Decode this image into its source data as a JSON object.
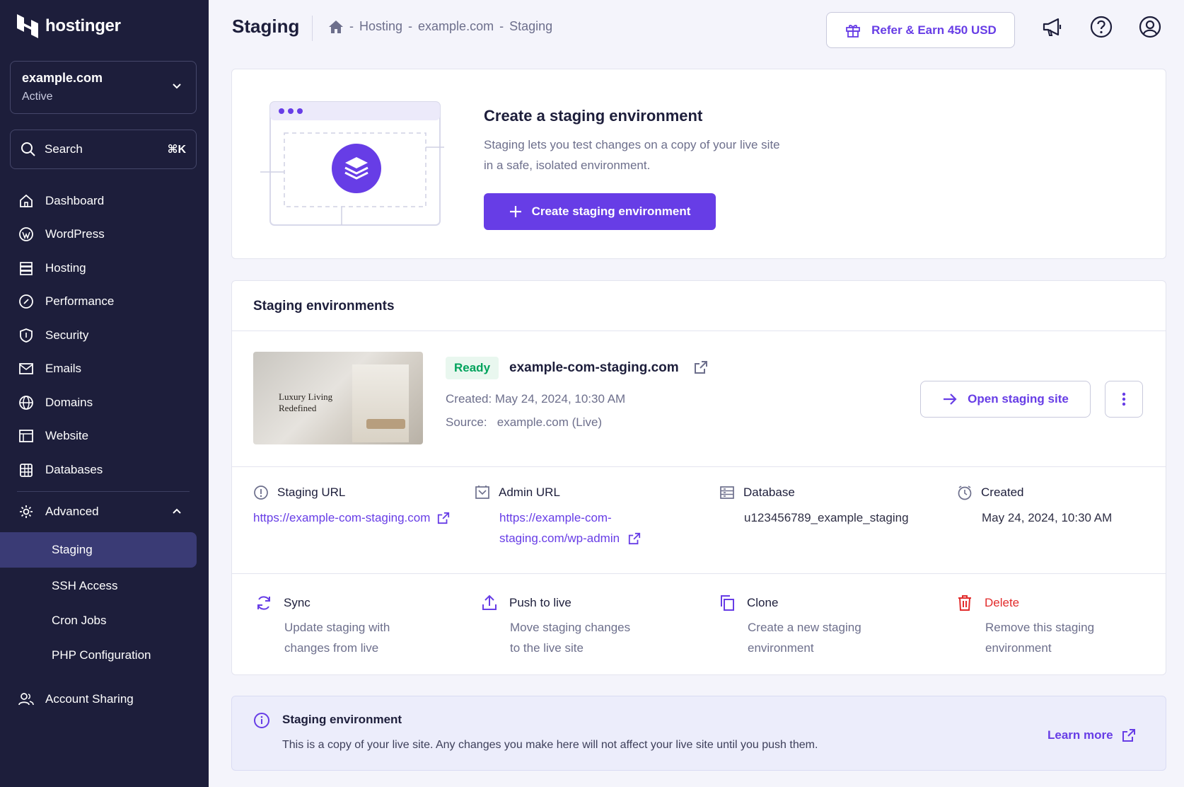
{
  "sidebar": {
    "brand": "hostinger",
    "site": {
      "name": "example.com",
      "status": "Active"
    },
    "search": {
      "label": "Search",
      "shortcut": "⌘K"
    },
    "nav": [
      {
        "label": "Dashboard",
        "icon": "home-icon"
      },
      {
        "label": "WordPress",
        "icon": "wordpress-icon"
      },
      {
        "label": "Hosting",
        "icon": "server-icon"
      },
      {
        "label": "Performance",
        "icon": "gauge-icon"
      },
      {
        "label": "Security",
        "icon": "shield-icon"
      },
      {
        "label": "Emails",
        "icon": "mail-icon"
      },
      {
        "label": "Domains",
        "icon": "globe-icon"
      },
      {
        "label": "Website",
        "icon": "browser-icon"
      },
      {
        "label": "Databases",
        "icon": "database-icon"
      }
    ],
    "advanced": {
      "label": "Advanced",
      "items": [
        "Staging",
        "SSH Access",
        "Cron Jobs",
        "PHP Configuration"
      ]
    },
    "account_sharing": "Account Sharing"
  },
  "header": {
    "title": "Staging",
    "breadcrumb": [
      "Hosting",
      "example.com",
      "Staging"
    ],
    "breadcrumb_sep": "-",
    "refer": "Refer & Earn 450 USD"
  },
  "create": {
    "title": "Create a staging environment",
    "desc_line1": "Staging lets you test changes on a copy of your live site",
    "desc_line2": "in a safe, isolated environment.",
    "button": "Create staging environment"
  },
  "environments": {
    "title": "Staging environments",
    "item": {
      "thumb_text_line1": "Luxury Living",
      "thumb_text_line2": "Redefined",
      "status": "Ready",
      "domain": "example-com-staging.com",
      "created": "Created: May 24, 2024, 10:30 AM",
      "source_label": "Source:",
      "source_value": "example.com (Live)",
      "open_button": "Open staging site"
    },
    "details": {
      "staging_url": {
        "label": "Staging URL",
        "value": "https://example-com-staging.com"
      },
      "admin_url": {
        "label": "Admin URL",
        "line1": "https://example-com-",
        "line2": "staging.com/wp-admin"
      },
      "database": {
        "label": "Database",
        "value": "u123456789_example_staging"
      },
      "created": {
        "label": "Created",
        "value": "May 24, 2024, 10:30 AM"
      }
    },
    "actions": {
      "sync": {
        "label": "Sync",
        "line1": "Update staging with",
        "line2": "changes from live"
      },
      "push": {
        "label": "Push to live",
        "line1": "Move staging changes",
        "line2": "to the live site"
      },
      "clone": {
        "label": "Clone",
        "line1": "Create a new staging",
        "line2": "environment"
      },
      "delete": {
        "label": "Delete",
        "line1": "Remove this staging",
        "line2": "environment"
      }
    }
  },
  "info": {
    "title": "Staging environment",
    "text": "This is a copy of your live site. Any changes you make here will not affect your live site until you push them.",
    "learn_more": "Learn more"
  },
  "colors": {
    "sidebar": "#1d1e3b",
    "accent": "#673de6",
    "success": "#00a35c",
    "danger": "#e22c2c"
  }
}
